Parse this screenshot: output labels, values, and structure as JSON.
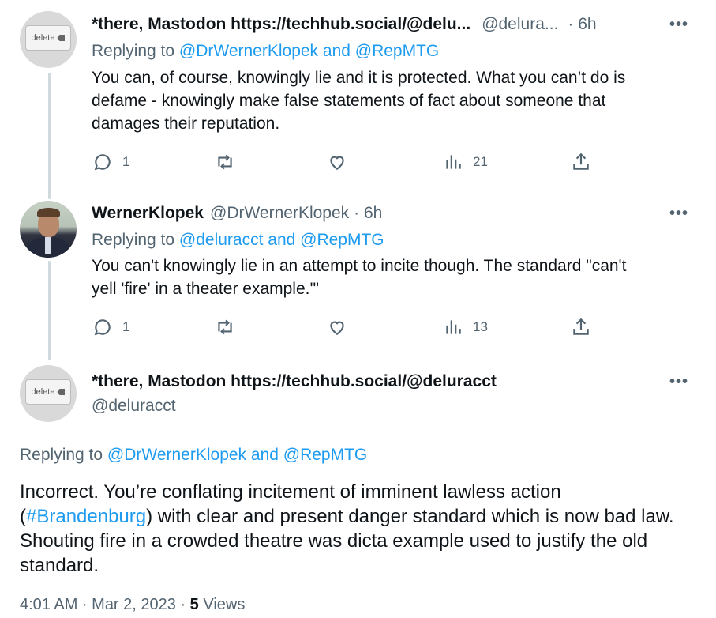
{
  "tweets": [
    {
      "name": "*there, Mastodon https://techhub.social/@delu...",
      "handle": "@delura...",
      "time": "· 6h",
      "replying_prefix": "Replying to ",
      "replying_to": "@DrWernerKlopek and @RepMTG",
      "text_line1": "You can, of course, knowingly lie and it is protected. What you can’t do is",
      "text_line2": "defame - knowingly make false statements of fact about someone that",
      "text_line3": "damages their reputation.",
      "replies": "1",
      "views": "21",
      "avatar_label": "delete"
    },
    {
      "name": "WernerKlopek",
      "handle": "@DrWernerKlopek",
      "time": "· 6h",
      "replying_prefix": "Replying to ",
      "replying_to": "@deluracct and @RepMTG",
      "text_line1": "You can't knowingly lie in an attempt to incite though. The standard \"can't",
      "text_line2": "yell 'fire' in a theater example.'\"",
      "replies": "1",
      "views": "13"
    }
  ],
  "main_tweet": {
    "name": "*there, Mastodon https://techhub.social/@deluracct",
    "handle": "@deluracct",
    "avatar_label": "delete",
    "replying_prefix": "Replying to ",
    "replying_to": "@DrWernerKlopek and @RepMTG",
    "text_part1": "Incorrect. You’re conflating incitement of imminent lawless action (",
    "hashtag": "#Brandenburg",
    "text_part2": ") with clear and present danger standard which is now bad law. Shouting fire in a crowded theatre was dicta example used to justify the old standard.",
    "time": "4:01 AM · Mar 2, 2023 · ",
    "views_count": "5",
    "views_label": " Views"
  },
  "more_label": "•••",
  "colors": {
    "link": "#1d9bf0",
    "muted": "#536471",
    "text": "#0f1419",
    "thread_line": "#cfd9de"
  }
}
